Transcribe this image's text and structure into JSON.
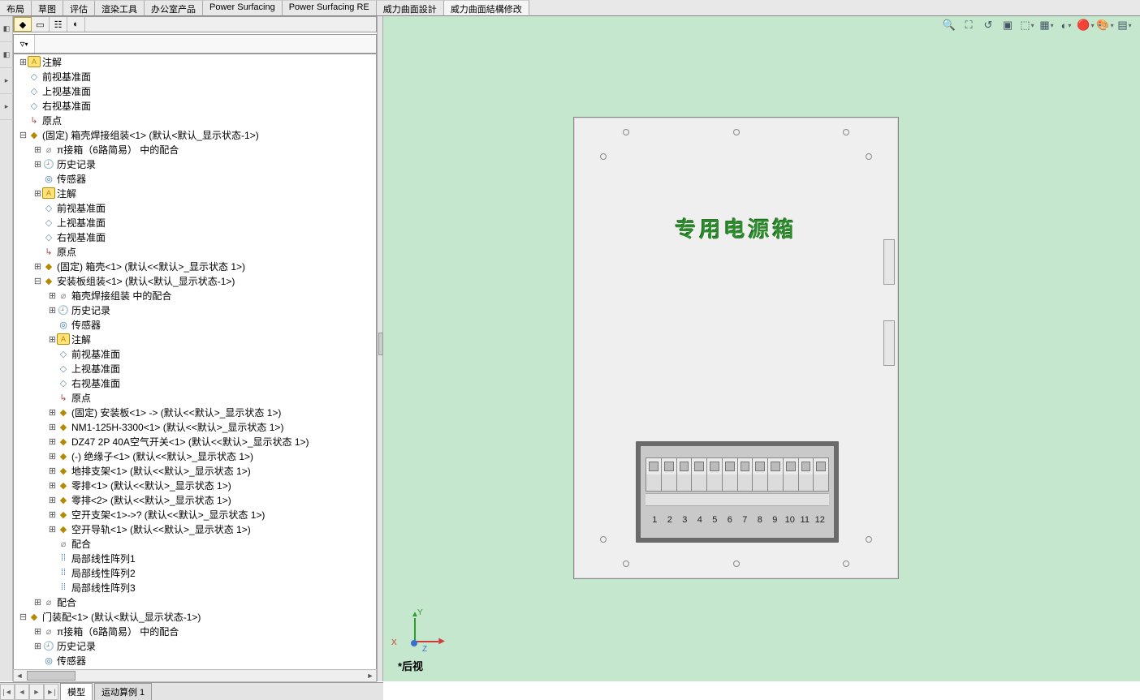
{
  "tabs": [
    "布局",
    "草图",
    "评估",
    "渲染工具",
    "办公室产品",
    "Power Surfacing",
    "Power Surfacing RE",
    "威力曲面設計",
    "威力曲面結構修改"
  ],
  "activeTabIndex": 8,
  "tree": [
    {
      "indent": 0,
      "tw": "plus",
      "icon": "ann",
      "label": "注解"
    },
    {
      "indent": 0,
      "tw": "none",
      "icon": "plane",
      "label": "前视基准面"
    },
    {
      "indent": 0,
      "tw": "none",
      "icon": "plane",
      "label": "上视基准面"
    },
    {
      "indent": 0,
      "tw": "none",
      "icon": "plane",
      "label": "右视基准面"
    },
    {
      "indent": 0,
      "tw": "none",
      "icon": "origin",
      "label": "原点"
    },
    {
      "indent": 0,
      "tw": "minus",
      "icon": "cube",
      "label": "(固定) 箱壳焊接组装<1> (默认<默认_显示状态-1>)"
    },
    {
      "indent": 1,
      "tw": "plus",
      "icon": "mate",
      "label": "π接箱（6路简易） 中的配合"
    },
    {
      "indent": 1,
      "tw": "plus",
      "icon": "hist",
      "label": "历史记录"
    },
    {
      "indent": 1,
      "tw": "none",
      "icon": "sensor",
      "label": "传感器"
    },
    {
      "indent": 1,
      "tw": "plus",
      "icon": "ann",
      "label": "注解"
    },
    {
      "indent": 1,
      "tw": "none",
      "icon": "plane",
      "label": "前视基准面"
    },
    {
      "indent": 1,
      "tw": "none",
      "icon": "plane",
      "label": "上视基准面"
    },
    {
      "indent": 1,
      "tw": "none",
      "icon": "plane",
      "label": "右视基准面"
    },
    {
      "indent": 1,
      "tw": "none",
      "icon": "origin",
      "label": "原点"
    },
    {
      "indent": 1,
      "tw": "plus",
      "icon": "cube",
      "label": "(固定) 箱壳<1> (默认<<默认>_显示状态 1>)"
    },
    {
      "indent": 1,
      "tw": "minus",
      "icon": "cube",
      "label": "安装板组装<1> (默认<默认_显示状态-1>)"
    },
    {
      "indent": 2,
      "tw": "plus",
      "icon": "mate",
      "label": "箱壳焊接组装 中的配合"
    },
    {
      "indent": 2,
      "tw": "plus",
      "icon": "hist",
      "label": "历史记录"
    },
    {
      "indent": 2,
      "tw": "none",
      "icon": "sensor",
      "label": "传感器"
    },
    {
      "indent": 2,
      "tw": "plus",
      "icon": "ann",
      "label": "注解"
    },
    {
      "indent": 2,
      "tw": "none",
      "icon": "plane",
      "label": "前视基准面"
    },
    {
      "indent": 2,
      "tw": "none",
      "icon": "plane",
      "label": "上视基准面"
    },
    {
      "indent": 2,
      "tw": "none",
      "icon": "plane",
      "label": "右视基准面"
    },
    {
      "indent": 2,
      "tw": "none",
      "icon": "origin",
      "label": "原点"
    },
    {
      "indent": 2,
      "tw": "plus",
      "icon": "cube",
      "label": "(固定) 安装板<1> -> (默认<<默认>_显示状态 1>)"
    },
    {
      "indent": 2,
      "tw": "plus",
      "icon": "cube",
      "label": "NM1-125H-3300<1> (默认<<默认>_显示状态 1>)"
    },
    {
      "indent": 2,
      "tw": "plus",
      "icon": "cube",
      "label": "DZ47 2P 40A空气开关<1> (默认<<默认>_显示状态 1>)"
    },
    {
      "indent": 2,
      "tw": "plus",
      "icon": "cube",
      "label": "(-) 绝缘子<1> (默认<<默认>_显示状态 1>)"
    },
    {
      "indent": 2,
      "tw": "plus",
      "icon": "cube",
      "label": "地排支架<1> (默认<<默认>_显示状态 1>)"
    },
    {
      "indent": 2,
      "tw": "plus",
      "icon": "cube",
      "label": "零排<1> (默认<<默认>_显示状态 1>)"
    },
    {
      "indent": 2,
      "tw": "plus",
      "icon": "cube",
      "label": "零排<2> (默认<<默认>_显示状态 1>)"
    },
    {
      "indent": 2,
      "tw": "plus",
      "icon": "cube",
      "label": "空开支架<1>->? (默认<<默认>_显示状态 1>)"
    },
    {
      "indent": 2,
      "tw": "plus",
      "icon": "cube",
      "label": "空开导轨<1> (默认<<默认>_显示状态 1>)"
    },
    {
      "indent": 2,
      "tw": "none",
      "icon": "mate",
      "label": "配合"
    },
    {
      "indent": 2,
      "tw": "none",
      "icon": "pattern",
      "label": "局部线性阵列1"
    },
    {
      "indent": 2,
      "tw": "none",
      "icon": "pattern",
      "label": "局部线性阵列2"
    },
    {
      "indent": 2,
      "tw": "none",
      "icon": "pattern",
      "label": "局部线性阵列3"
    },
    {
      "indent": 1,
      "tw": "plus",
      "icon": "mate",
      "label": "配合"
    },
    {
      "indent": 0,
      "tw": "minus",
      "icon": "cube",
      "label": "门装配<1> (默认<默认_显示状态-1>)"
    },
    {
      "indent": 1,
      "tw": "plus",
      "icon": "mate",
      "label": "π接箱（6路简易） 中的配合"
    },
    {
      "indent": 1,
      "tw": "plus",
      "icon": "hist",
      "label": "历史记录"
    },
    {
      "indent": 1,
      "tw": "none",
      "icon": "sensor",
      "label": "传感器"
    }
  ],
  "viewport": {
    "title": "专用电源箱",
    "numbers": [
      "1",
      "2",
      "3",
      "4",
      "5",
      "6",
      "7",
      "8",
      "9",
      "10",
      "11",
      "12"
    ],
    "view_label": "*后视",
    "axes": {
      "x": "X",
      "y": "Y",
      "z": "Z"
    }
  },
  "bottom_tabs": [
    "模型",
    "运动算例 1"
  ],
  "icons": {
    "cube": "◆",
    "plane": "◇",
    "ann": "A",
    "hist": "🕘",
    "sensor": "◎",
    "origin": "↳",
    "mate": "⌀",
    "pattern": "⁞⁞"
  }
}
